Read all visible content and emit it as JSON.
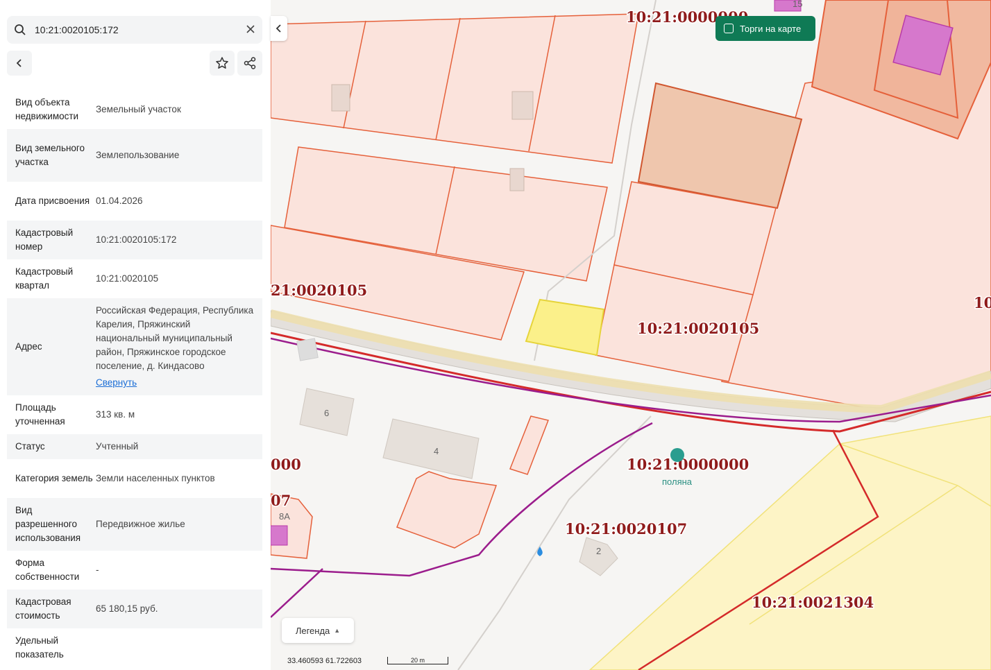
{
  "search": {
    "query": "10:21:0020105:172",
    "search_icon": "search-icon",
    "close_icon": "close-icon"
  },
  "toolbar": {
    "back_icon": "back-arrow-icon",
    "star_icon": "star-icon",
    "share_icon": "share-icon"
  },
  "details": [
    {
      "key": "Вид объекта недвижимости",
      "value": "Земельный участок"
    },
    {
      "key": "Вид земельного участка",
      "value": "Землепользование"
    },
    {
      "key": "Дата присвоения",
      "value": "01.04.2026"
    },
    {
      "key": "Кадастровый номер",
      "value": "10:21:0020105:172"
    },
    {
      "key": "Кадастровый квартал",
      "value": "10:21:0020105"
    },
    {
      "key": "Адрес",
      "value": "Российская Федерация, Республика Карелия, Пряжинский национальный муниципальный район, Пряжинское городское поселение, д. Киндасово",
      "link": "Свернуть"
    },
    {
      "key": "Площадь уточненная",
      "value": "313 кв. м"
    },
    {
      "key": "Статус",
      "value": "Учтенный"
    },
    {
      "key": "Категория земель",
      "value": "Земли населенных пунктов"
    },
    {
      "key": "Вид разрешенного использования",
      "value": "Передвижное жилье"
    },
    {
      "key": "Форма собственности",
      "value": "-"
    },
    {
      "key": "Кадастровая стоимость",
      "value": "65 180,15 руб."
    },
    {
      "key": "Удельный показатель",
      "value": ""
    }
  ],
  "map": {
    "torgi_label": "Торги на карте",
    "legend_label": "Легенда",
    "coords": "33.460593   61.722603",
    "scale_label": "20 m",
    "cadastral_labels": [
      "10:21:0000000",
      "21:0020105",
      "10:21:0020105",
      "000",
      "07",
      "10:21:0000000",
      "10:21:0020107",
      "10:21:0021304",
      "10"
    ],
    "house_numbers": [
      "6",
      "4",
      "2",
      "8А",
      "15"
    ],
    "place_name": "поляна",
    "colors": {
      "parcel_stroke": "#e5603a",
      "parcel_fill": "#fbe3dc",
      "selected_fill": "#fbf08a",
      "zone_fill": "#fdf4c6",
      "boundary": "#d42a2a",
      "purple_line": "#9b1c8c",
      "torgi_bg": "#0f7a55"
    }
  }
}
